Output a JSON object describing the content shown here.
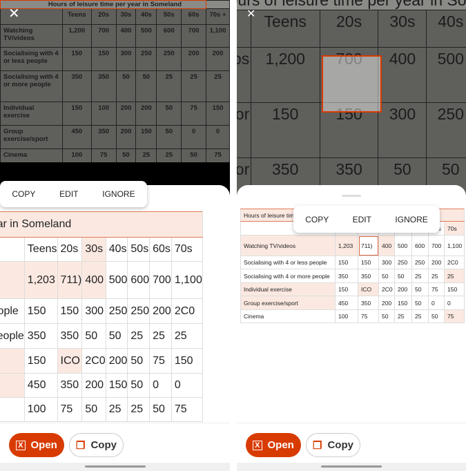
{
  "photo_table": {
    "title": "Hours of leisure time per year in Someland",
    "headers": [
      "",
      "Teens",
      "20s",
      "30s",
      "40s",
      "50s",
      "60s",
      "70s +"
    ],
    "rows": [
      [
        "Watching TV/videos",
        "1,200",
        "700",
        "400",
        "500",
        "600",
        "700",
        "1,100"
      ],
      [
        "Socialising with 4 or less people",
        "150",
        "150",
        "300",
        "250",
        "250",
        "200",
        "200"
      ],
      [
        "Socialising with 4 or more people",
        "350",
        "350",
        "50",
        "50",
        "25",
        "25",
        "25"
      ],
      [
        "Individual exercise",
        "150",
        "100",
        "200",
        "200",
        "50",
        "75",
        "150"
      ],
      [
        "Group exercise/sport",
        "450",
        "350",
        "200",
        "150",
        "50",
        "0",
        "0"
      ],
      [
        "Cinema",
        "100",
        "75",
        "50",
        "25",
        "25",
        "50",
        "75"
      ]
    ]
  },
  "recognized_table": {
    "title": "Hours of leisure time per year in Someland",
    "headers": [
      "",
      "Teens",
      "20s",
      "30s",
      "40s",
      "50s",
      "60s",
      "70s"
    ],
    "rows": [
      [
        "Watching TV/videos",
        "1,203",
        "711)",
        "400",
        "500",
        "600",
        "700",
        "1,100"
      ],
      [
        "Socialising with 4 or less people",
        "150",
        "150",
        "300",
        "250",
        "250",
        "200",
        "2C0"
      ],
      [
        "Socialising with 4 or more people",
        "350",
        "350",
        "50",
        "50",
        "25",
        "25",
        "25"
      ],
      [
        "Individual exercise",
        "150",
        "ICO",
        "2C0",
        "200",
        "50",
        "75",
        "150"
      ],
      [
        "Group exercise/sport",
        "450",
        "350",
        "200",
        "150",
        "50",
        "0",
        "0"
      ],
      [
        "Cinema",
        "100",
        "75",
        "50",
        "25",
        "25",
        "50",
        "75"
      ]
    ]
  },
  "popup": {
    "copy": "COPY",
    "edit": "EDIT",
    "ignore": "IGNORE"
  },
  "actions": {
    "open": "Open",
    "copy": "Copy"
  },
  "colors": {
    "accent": "#d83b01",
    "flag": "#fbe9e1"
  }
}
